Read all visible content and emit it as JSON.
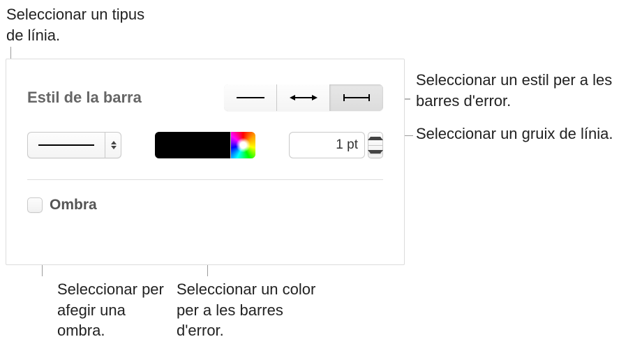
{
  "callouts": {
    "line_type": "Seleccionar un tipus de línia.",
    "error_style": "Seleccionar un estil per a les barres d'error.",
    "line_width": "Seleccionar un gruix de línia.",
    "shadow": "Seleccionar per afegir una ombra.",
    "color": "Seleccionar un color per a les barres d'error."
  },
  "panel": {
    "title": "Estil de la barra",
    "segmented": {
      "options": [
        "line",
        "arrow-ends",
        "tee-ends"
      ],
      "selected_index": 2
    },
    "line_popup": {
      "value": "solid"
    },
    "color": {
      "swatch_hex": "#000000"
    },
    "width": {
      "value": "1 pt"
    },
    "shadow": {
      "label": "Ombra",
      "checked": false
    }
  }
}
